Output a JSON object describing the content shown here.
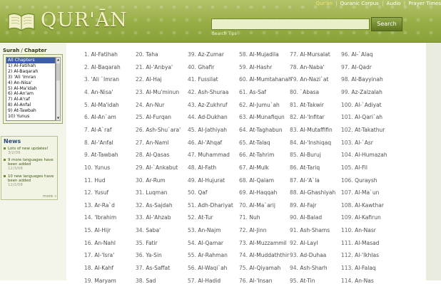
{
  "header": {
    "logo_text": "QUR'ĀN",
    "nav": [
      "Qur'ān",
      "Quranic Corpus",
      "Audio",
      "Prayer Times"
    ],
    "nav_separator": "|",
    "search": {
      "value": "",
      "button": "Search",
      "tips": "Search Tips"
    },
    "colors": {
      "header_green": "#97ad45",
      "nav_highlight": "#f3e56f",
      "link_blue": "#2c4a7a"
    }
  },
  "sidebar": {
    "surah_heading": {
      "a": "Surah",
      "b": "Chapter"
    },
    "chapter_options": [
      "All Chapters",
      "1) Al-Fatihah",
      "2) Al-Baqarah",
      "3) 'Ali 'Imran",
      "4) An-Nisa'",
      "5) Al-Ma'idah",
      "6) Al-An'am",
      "7) Al-A'raf",
      "8) Al-Anfal",
      "9) At-Tawbah",
      "10) Yunus"
    ],
    "selected_option": "All Chapters",
    "news": {
      "title": "News",
      "items": [
        {
          "text": "Lots of new updates!",
          "date": "3/2/09"
        },
        {
          "text": "9 more languages have been added",
          "date": "12/3/08"
        },
        {
          "text": "10 new languages have been added",
          "date": "12/2/08"
        }
      ],
      "more": "more »"
    }
  },
  "chapters": [
    [
      {
        "n": "1.",
        "name": "Al-Fatihah"
      },
      {
        "n": "2.",
        "name": "Al-Baqarah"
      },
      {
        "n": "3.",
        "name": "'Ali `Imran"
      },
      {
        "n": "4.",
        "name": "An-Nisa'"
      },
      {
        "n": "5.",
        "name": "Al-Ma'idah"
      },
      {
        "n": "6.",
        "name": "Al-An`am"
      },
      {
        "n": "7.",
        "name": "Al-A`raf"
      },
      {
        "n": "8.",
        "name": "Al-'Anfal"
      },
      {
        "n": "9.",
        "name": "At-Tawbah"
      },
      {
        "n": "10.",
        "name": "Yunus"
      },
      {
        "n": "11.",
        "name": "Hud"
      },
      {
        "n": "12.",
        "name": "Yusuf"
      },
      {
        "n": "13.",
        "name": "Ar-Ra`d"
      },
      {
        "n": "14.",
        "name": "'Ibrahim"
      },
      {
        "n": "15.",
        "name": "Al-Hijr"
      },
      {
        "n": "16.",
        "name": "An-Nahl"
      },
      {
        "n": "17.",
        "name": "Al-'Isra'"
      },
      {
        "n": "18.",
        "name": "Al-Kahf"
      },
      {
        "n": "19.",
        "name": "Maryam"
      }
    ],
    [
      {
        "n": "20.",
        "name": "Taha"
      },
      {
        "n": "21.",
        "name": "Al-'Anbya'"
      },
      {
        "n": "22.",
        "name": "Al-Haj"
      },
      {
        "n": "23.",
        "name": "Al-Mu'minun"
      },
      {
        "n": "24.",
        "name": "An-Nur"
      },
      {
        "n": "25.",
        "name": "Al-Furqan"
      },
      {
        "n": "26.",
        "name": "Ash-Shu`ara'"
      },
      {
        "n": "27.",
        "name": "An-Naml"
      },
      {
        "n": "28.",
        "name": "Al-Qasas"
      },
      {
        "n": "29.",
        "name": "Al-`Ankabut"
      },
      {
        "n": "30.",
        "name": "Ar-Rum"
      },
      {
        "n": "31.",
        "name": "Luqman"
      },
      {
        "n": "32.",
        "name": "As-Sajdah"
      },
      {
        "n": "33.",
        "name": "Al-'Ahzab"
      },
      {
        "n": "34.",
        "name": "Saba'"
      },
      {
        "n": "35.",
        "name": "Fatir"
      },
      {
        "n": "36.",
        "name": "Ya-Sin"
      },
      {
        "n": "37.",
        "name": "As-Saffat"
      },
      {
        "n": "38.",
        "name": "Sad"
      }
    ],
    [
      {
        "n": "39.",
        "name": "Az-Zumar"
      },
      {
        "n": "40.",
        "name": "Ghafir"
      },
      {
        "n": "41.",
        "name": "Fussilat"
      },
      {
        "n": "42.",
        "name": "Ash-Shuraa"
      },
      {
        "n": "43.",
        "name": "Az-Zukhruf"
      },
      {
        "n": "44.",
        "name": "Ad-Dukhan"
      },
      {
        "n": "45.",
        "name": "Al-Jathiyah"
      },
      {
        "n": "46.",
        "name": "Al-'Ahqaf"
      },
      {
        "n": "47.",
        "name": "Muhammad"
      },
      {
        "n": "48.",
        "name": "Al-Fath"
      },
      {
        "n": "49.",
        "name": "Al-Hujurat"
      },
      {
        "n": "50.",
        "name": "Qaf"
      },
      {
        "n": "51.",
        "name": "Adh-Dhariyat"
      },
      {
        "n": "52.",
        "name": "At-Tur"
      },
      {
        "n": "53.",
        "name": "An-Najm"
      },
      {
        "n": "54.",
        "name": "Al-Qamar"
      },
      {
        "n": "55.",
        "name": "Ar-Rahman"
      },
      {
        "n": "56.",
        "name": "Al-Waqi`ah"
      },
      {
        "n": "57.",
        "name": "Al-Hadid"
      }
    ],
    [
      {
        "n": "58.",
        "name": "Al-Mujadila"
      },
      {
        "n": "59.",
        "name": "Al-Hashr"
      },
      {
        "n": "60.",
        "name": "Al-Mumtahanah"
      },
      {
        "n": "61.",
        "name": "As-Saf"
      },
      {
        "n": "62.",
        "name": "Al-Jumu`ah"
      },
      {
        "n": "63.",
        "name": "Al-Munafiqun"
      },
      {
        "n": "64.",
        "name": "At-Taghabun"
      },
      {
        "n": "65.",
        "name": "At-Talaq"
      },
      {
        "n": "66.",
        "name": "At-Tahrim"
      },
      {
        "n": "67.",
        "name": "Al-Mulk"
      },
      {
        "n": "68.",
        "name": "Al-Qalam"
      },
      {
        "n": "69.",
        "name": "Al-Haqqah"
      },
      {
        "n": "70.",
        "name": "Al-Ma`arij"
      },
      {
        "n": "71.",
        "name": "Nuh"
      },
      {
        "n": "72.",
        "name": "Al-Jinn"
      },
      {
        "n": "73.",
        "name": "Al-Muzzammil"
      },
      {
        "n": "74.",
        "name": "Al-Muddaththir"
      },
      {
        "n": "75.",
        "name": "Al-Qiyamah"
      },
      {
        "n": "76.",
        "name": "Al-'Insan"
      }
    ],
    [
      {
        "n": "77.",
        "name": "Al-Mursalat"
      },
      {
        "n": "78.",
        "name": "An-Naba'"
      },
      {
        "n": "79.",
        "name": "An-Nazi`at"
      },
      {
        "n": "80.",
        "name": "`Abasa"
      },
      {
        "n": "81.",
        "name": "At-Takwir"
      },
      {
        "n": "82.",
        "name": "Al-'Infitar"
      },
      {
        "n": "83.",
        "name": "Al-Mutaffifin"
      },
      {
        "n": "84.",
        "name": "Al-'Inshiqaq"
      },
      {
        "n": "85.",
        "name": "Al-Buruj"
      },
      {
        "n": "86.",
        "name": "At-Tariq"
      },
      {
        "n": "87.",
        "name": "Al-'A`la"
      },
      {
        "n": "88.",
        "name": "Al-Ghashiyah"
      },
      {
        "n": "89.",
        "name": "Al-Fajr"
      },
      {
        "n": "90.",
        "name": "Al-Balad"
      },
      {
        "n": "91.",
        "name": "Ash-Shams"
      },
      {
        "n": "92.",
        "name": "Al-Layl"
      },
      {
        "n": "93.",
        "name": "Ad-Duhaa"
      },
      {
        "n": "94.",
        "name": "Ash-Sharh"
      },
      {
        "n": "95.",
        "name": "At-Tin"
      }
    ],
    [
      {
        "n": "96.",
        "name": "Al-`Alaq"
      },
      {
        "n": "97.",
        "name": "Al-Qadr"
      },
      {
        "n": "98.",
        "name": "Al-Bayyinah"
      },
      {
        "n": "99.",
        "name": "Az-Zalzalah"
      },
      {
        "n": "100.",
        "name": "Al-`Adiyat"
      },
      {
        "n": "101.",
        "name": "Al-Qari`ah"
      },
      {
        "n": "102.",
        "name": "At-Takathur"
      },
      {
        "n": "103.",
        "name": "Al-`Asr"
      },
      {
        "n": "104.",
        "name": "Al-Humazah"
      },
      {
        "n": "105.",
        "name": "Al-Fil"
      },
      {
        "n": "106.",
        "name": "Quraysh"
      },
      {
        "n": "107.",
        "name": "Al-Ma`un"
      },
      {
        "n": "108.",
        "name": "Al-Kawthar"
      },
      {
        "n": "109.",
        "name": "Al-Kafirun"
      },
      {
        "n": "110.",
        "name": "An-Nasr"
      },
      {
        "n": "111.",
        "name": "Al-Masad"
      },
      {
        "n": "112.",
        "name": "Al-'Ikhlas"
      },
      {
        "n": "113.",
        "name": "Al-Falaq"
      },
      {
        "n": "114.",
        "name": "An-Nas"
      }
    ]
  ]
}
